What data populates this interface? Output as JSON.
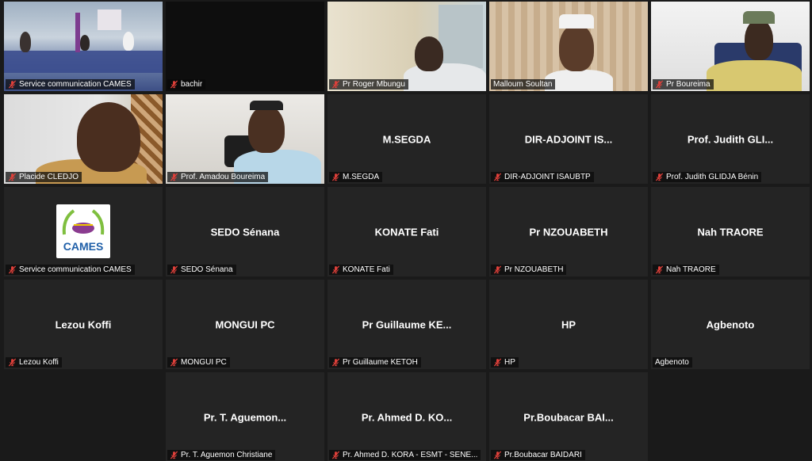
{
  "participants": [
    {
      "label": "Service communication CAMES",
      "display": "",
      "muted": true,
      "video": "meeting-room",
      "active": true
    },
    {
      "label": "bachir",
      "display": "",
      "muted": true,
      "video": "black"
    },
    {
      "label": "Pr Roger Mbungu",
      "display": "",
      "muted": true,
      "video": "office-man"
    },
    {
      "label": "Malloum Soultan",
      "display": "",
      "muted": false,
      "video": "curtain-man"
    },
    {
      "label": "Pr Boureima",
      "display": "",
      "muted": true,
      "video": "white-room-man"
    },
    {
      "label": "Placide CLEDJO",
      "display": "",
      "muted": true,
      "video": "bald-man"
    },
    {
      "label": "Prof. Amadou Boureima",
      "display": "",
      "muted": true,
      "video": "cap-man"
    },
    {
      "label": "M.SEGDA",
      "display": "M.SEGDA",
      "muted": true
    },
    {
      "label": "DIR-ADJOINT ISAUBTP",
      "display": "DIR-ADJOINT  IS...",
      "muted": true
    },
    {
      "label": "Prof. Judith GLIDJA Bénin",
      "display": "Prof. Judith GLI...",
      "muted": true
    },
    {
      "label": "Service communication CAMES",
      "display": "",
      "muted": true,
      "video": "logo",
      "logo_text": "CAMES"
    },
    {
      "label": "SEDO Sénana",
      "display": "SEDO Sénana",
      "muted": true
    },
    {
      "label": "KONATE Fati",
      "display": "KONATE Fati",
      "muted": true
    },
    {
      "label": "Pr NZOUABETH",
      "display": "Pr NZOUABETH",
      "muted": true
    },
    {
      "label": "Nah TRAORE",
      "display": "Nah TRAORE",
      "muted": true
    },
    {
      "label": "Lezou Koffi",
      "display": "Lezou Koffi",
      "muted": true
    },
    {
      "label": "MONGUI PC",
      "display": "MONGUI PC",
      "muted": true
    },
    {
      "label": "Pr Guillaume KETOH",
      "display": "Pr Guillaume KE...",
      "muted": true
    },
    {
      "label": "HP",
      "display": "HP",
      "muted": true
    },
    {
      "label": "Agbenoto",
      "display": "Agbenoto",
      "muted": false
    },
    {
      "label": "Pr. T. Aguemon Christiane",
      "display": "Pr. T. Aguemon...",
      "muted": true
    },
    {
      "label": "Pr. Ahmed D. KORA - ESMT - SENE...",
      "display": "Pr. Ahmed D. KO...",
      "muted": true
    },
    {
      "label": "Pr.Boubacar BAIDARI",
      "display": "Pr.Boubacar BAI...",
      "muted": true
    }
  ],
  "colors": {
    "active_border": "#d7e83a",
    "mute": "#e0403a",
    "tile_bg": "#242424"
  }
}
